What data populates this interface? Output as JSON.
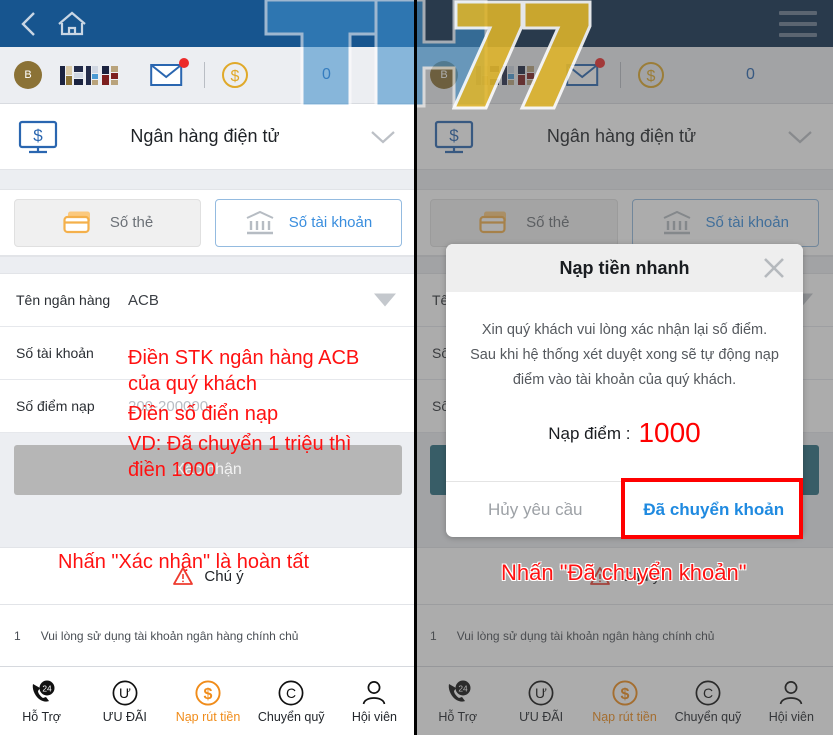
{
  "header": {
    "back_icon": "chevron-left-icon",
    "home_icon": "home-icon",
    "menu_icon": "hamburger-menu-icon"
  },
  "account": {
    "avatar_letter": "B",
    "username_masked": "",
    "mail_icon": "envelope-icon",
    "coin_icon": "dollar-coin-icon",
    "balance": "0"
  },
  "section": {
    "icon": "monitor-dollar-icon",
    "title": "Ngân hàng điện tử",
    "chevron": "chevron-down-icon"
  },
  "tabs": [
    {
      "label": "Số thẻ",
      "icon": "credit-cards-icon",
      "active": false
    },
    {
      "label": "Số tài khoản",
      "icon": "bank-icon",
      "active": true
    }
  ],
  "form": {
    "rows": [
      {
        "label": "Tên ngân hàng",
        "value": "ACB",
        "placeholder": "",
        "has_caret": true
      },
      {
        "label": "Số tài khoản",
        "value": "",
        "placeholder": "",
        "has_caret": false
      },
      {
        "label": "Số điểm nạp",
        "value": "",
        "placeholder": "200-200000",
        "has_caret": false
      }
    ],
    "submit_label": "Xác nhận"
  },
  "notice": {
    "icon": "warning-triangle-icon",
    "label": "Chú ý",
    "tip_number": "1",
    "tip_text": "Vui lòng sử dụng tài khoản ngân hàng chính chủ"
  },
  "bottom_nav": [
    {
      "label": "Hỗ Trợ",
      "icon": "phone-24h-icon",
      "active": false
    },
    {
      "label": "ƯU ĐÃI",
      "icon": "u-circle-icon",
      "active": false
    },
    {
      "label": "Nạp rút tiền",
      "icon": "dollar-circle-icon",
      "active": true
    },
    {
      "label": "Chuyển quỹ",
      "icon": "c-circle-icon",
      "active": false
    },
    {
      "label": "Hội viên",
      "icon": "user-icon",
      "active": false
    }
  ],
  "annotations": {
    "left": [
      "Điền STK ngân hàng ACB",
      "của quý khách",
      "Điền số điển nạp",
      "VD: Đã chuyển 1 triệu thì",
      "điền 1000",
      "Nhấn \"Xác nhận\" là hoàn tất"
    ],
    "right": "Nhấn \"Đã chuyển khoản\""
  },
  "modal": {
    "title": "Nạp tiền nhanh",
    "close_icon": "close-x-icon",
    "body_line1": "Xin quý khách vui lòng xác nhận lại số điểm.",
    "body_line2": "Sau khi hệ thống xét duyệt xong sẽ tự động nạp",
    "body_line3": "điểm vào tài khoản của quý khách.",
    "amount_label": "Nạp điểm :",
    "amount_value": "1000",
    "cancel_label": "Hủy yêu cầu",
    "confirm_label": "Đã chuyển khoản"
  },
  "watermark": {
    "text_blue": "TH",
    "text_gold": "77"
  },
  "colors": {
    "topbar": "#17558f",
    "topbar_dark": "#0d2d4f",
    "accent_blue": "#2a66b0",
    "link_blue": "#3a8ede",
    "orange": "#f08c1a",
    "red": "#ff0000",
    "teal": "#2a6e80",
    "gold": "#e0b52a"
  }
}
